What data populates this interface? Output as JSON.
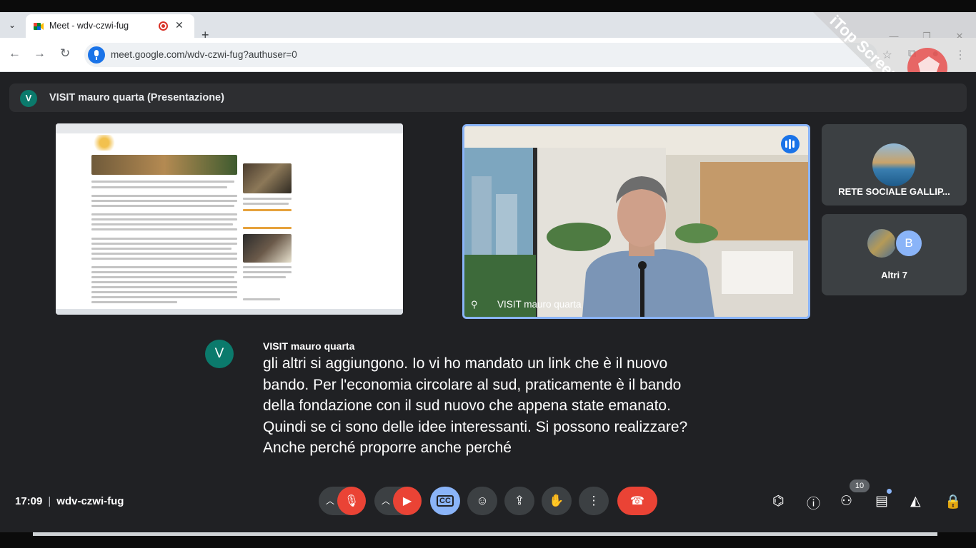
{
  "browser": {
    "tab_title": "Meet - wdv-czwi-fug",
    "url": "meet.google.com/wdv-czwi-fug?authuser=0"
  },
  "watermark": "iTop Screen Recorder",
  "presentation": {
    "avatar_letter": "V",
    "title": "VISIT mauro quarta (Presentazione)"
  },
  "main_video": {
    "name": "VISIT mauro quarta"
  },
  "participants": [
    {
      "label": "RETE SOCIALE GALLIP..."
    },
    {
      "label": "Altri 7",
      "avatar_letter": "B"
    }
  ],
  "caption": {
    "avatar_letter": "V",
    "speaker": "VISIT mauro quarta",
    "lines": [
      "gli altri si aggiungono. Io vi ho mandato un link che è il nuovo",
      "bando. Per l'economia circolare al sud, praticamente è il bando",
      "della fondazione con il sud nuovo che appena state emanato.",
      "Quindi se ci sono delle idee interessanti. Si possono realizzare?",
      "Anche perché proporre anche perché"
    ]
  },
  "meeting": {
    "time": "17:09",
    "code": "wdv-czwi-fug",
    "cc_label": "CC",
    "people_count": "10"
  },
  "colors": {
    "accent": "#8ab4f8",
    "danger": "#ea4335",
    "avatar": "#0b7a6c",
    "background": "#202124"
  }
}
